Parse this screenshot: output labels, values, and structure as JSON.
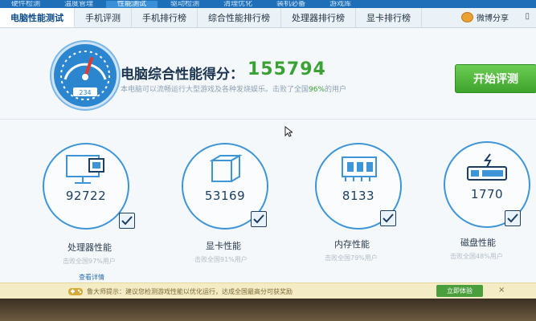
{
  "top_nav": {
    "items": [
      "硬件检测",
      "温度管理",
      "性能测试",
      "驱动检测",
      "清理优化",
      "装机必备",
      "游戏库"
    ],
    "active_index": 2
  },
  "tabs": [
    "电脑性能测试",
    "手机评测",
    "手机排行榜",
    "综合性能排行榜",
    "处理器排行榜",
    "显卡排行榜"
  ],
  "share": {
    "label": "微博分享"
  },
  "header": {
    "gauge_value": "234",
    "title": "电脑综合性能得分：",
    "score": "155794",
    "desc_before": "本电脑可以流畅运行大型游戏及各种发烧娱乐。击败了全国",
    "desc_pct": "96%",
    "desc_after": "的用户",
    "start_button": "开始评测"
  },
  "cards": [
    {
      "value": "92722",
      "label": "处理器性能",
      "sub": "击败全国97%用户",
      "link": "查看详情",
      "icon": "monitor-chip-icon"
    },
    {
      "value": "53169",
      "label": "显卡性能",
      "sub": "击败全国91%用户",
      "icon": "cube-icon"
    },
    {
      "value": "8133",
      "label": "内存性能",
      "sub": "击败全国79%用户",
      "icon": "ram-chip-icon"
    },
    {
      "value": "1770",
      "label": "磁盘性能",
      "sub": "击败全国48%用户",
      "icon": "disk-drive-icon"
    }
  ],
  "footer": {
    "text": "鲁大师提示：建议您检测游戏性能以优化运行，达成全国最高分可获奖励",
    "button": "立即体验",
    "close": "×"
  },
  "colors": {
    "accent": "#3d95d8",
    "score_green": "#3aa235",
    "nav_blue": "#1e6fb8"
  }
}
